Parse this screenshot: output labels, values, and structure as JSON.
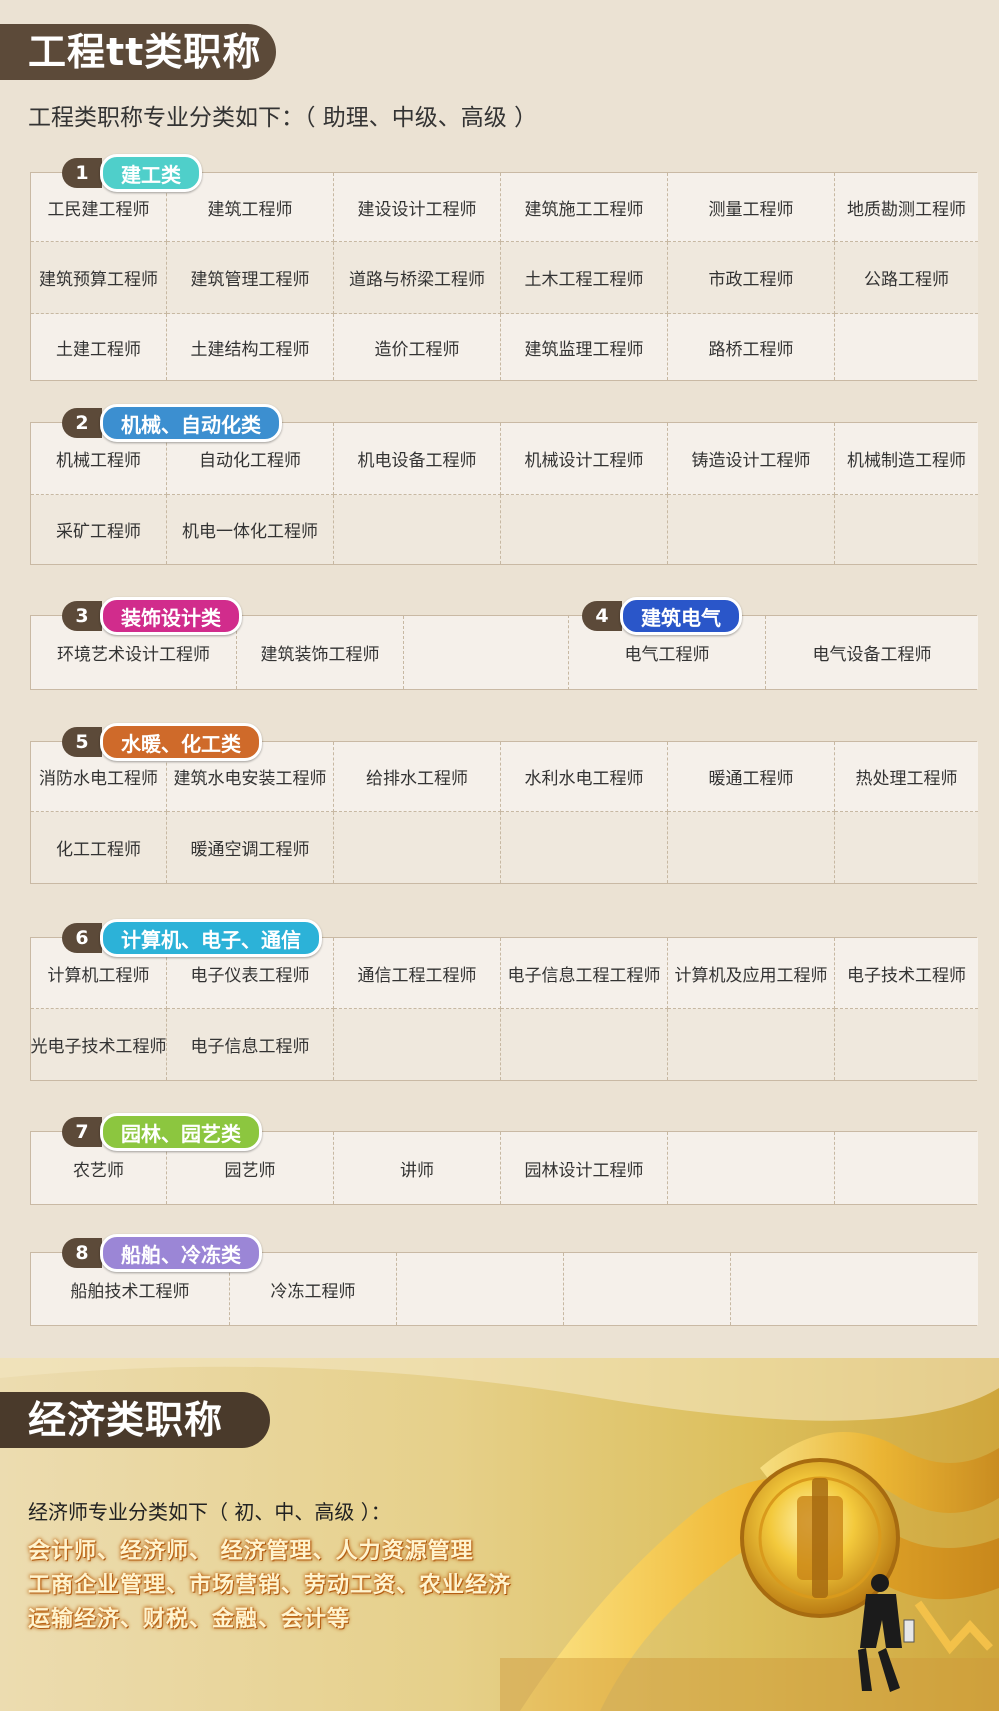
{
  "engineering": {
    "title": "工程tt类职称",
    "intro": "工程类职称专业分类如下：（ 助理、中级、高级 ）",
    "sections": [
      {
        "num": "1",
        "label": "建工类",
        "color": "#4fcfca",
        "rows": [
          [
            "工民建工程师",
            "建筑工程师",
            "建设设计工程师",
            "建筑施工工程师",
            "测量工程师",
            "地质勘测工程师"
          ],
          [
            "建筑预算工程师",
            "建筑管理工程师",
            "道路与桥梁工程师",
            "土木工程工程师",
            "市政工程师",
            "公路工程师"
          ],
          [
            "土建工程师",
            "土建结构工程师",
            "造价工程师",
            "建筑监理工程师",
            "路桥工程师",
            ""
          ]
        ]
      },
      {
        "num": "2",
        "label": "机械、自动化类",
        "color": "#3c8fd0",
        "rows": [
          [
            "机械工程师",
            "自动化工程师",
            "机电设备工程师",
            "机械设计工程师",
            "铸造设计工程师",
            "机械制造工程师"
          ],
          [
            "采矿工程师",
            "机电一体化工程师",
            "",
            "",
            "",
            ""
          ]
        ]
      },
      {
        "num": "3",
        "label": "装饰设计类",
        "color": "#d12c8c",
        "rows": [
          [
            "环境艺术设计工程师",
            "建筑装饰工程师",
            ""
          ]
        ]
      },
      {
        "num": "4",
        "label": "建筑电气",
        "color": "#2a56c9",
        "rows": [
          [
            "电气工程师",
            "电气设备工程师"
          ]
        ]
      },
      {
        "num": "5",
        "label": "水暖、化工类",
        "color": "#cf6a2a",
        "rows": [
          [
            "消防水电工程师",
            "建筑水电安装工程师",
            "给排水工程师",
            "水利水电工程师",
            "暖通工程师",
            "热处理工程师"
          ],
          [
            "化工工程师",
            "暖通空调工程师",
            "",
            "",
            "",
            ""
          ]
        ]
      },
      {
        "num": "6",
        "label": "计算机、电子、通信",
        "color": "#2cb2d8",
        "rows": [
          [
            "计算机工程师",
            "电子仪表工程师",
            "通信工程工程师",
            "电子信息工程工程师",
            "计算机及应用工程师",
            "电子技术工程师"
          ],
          [
            "光电子技术工程师",
            "电子信息工程师",
            "",
            "",
            "",
            ""
          ]
        ]
      },
      {
        "num": "7",
        "label": "园林、园艺类",
        "color": "#8cc63f",
        "rows": [
          [
            "农艺师",
            "园艺师",
            "讲师",
            "园林设计工程师",
            "",
            ""
          ]
        ]
      },
      {
        "num": "8",
        "label": "船舶、冷冻类",
        "color": "#9b86d6",
        "rows": [
          [
            "船舶技术工程师",
            "冷冻工程师",
            "",
            "",
            ""
          ]
        ]
      }
    ]
  },
  "economics": {
    "title": "经济类职称",
    "intro": "经济师专业分类如下（ 初、中、高级 ）：",
    "lines": [
      "会计师、经济师、 经济管理、人力资源管理",
      "工商企业管理、市场营销、劳动工资、农业经济",
      "运输经济、财税、金融、会计等"
    ]
  }
}
